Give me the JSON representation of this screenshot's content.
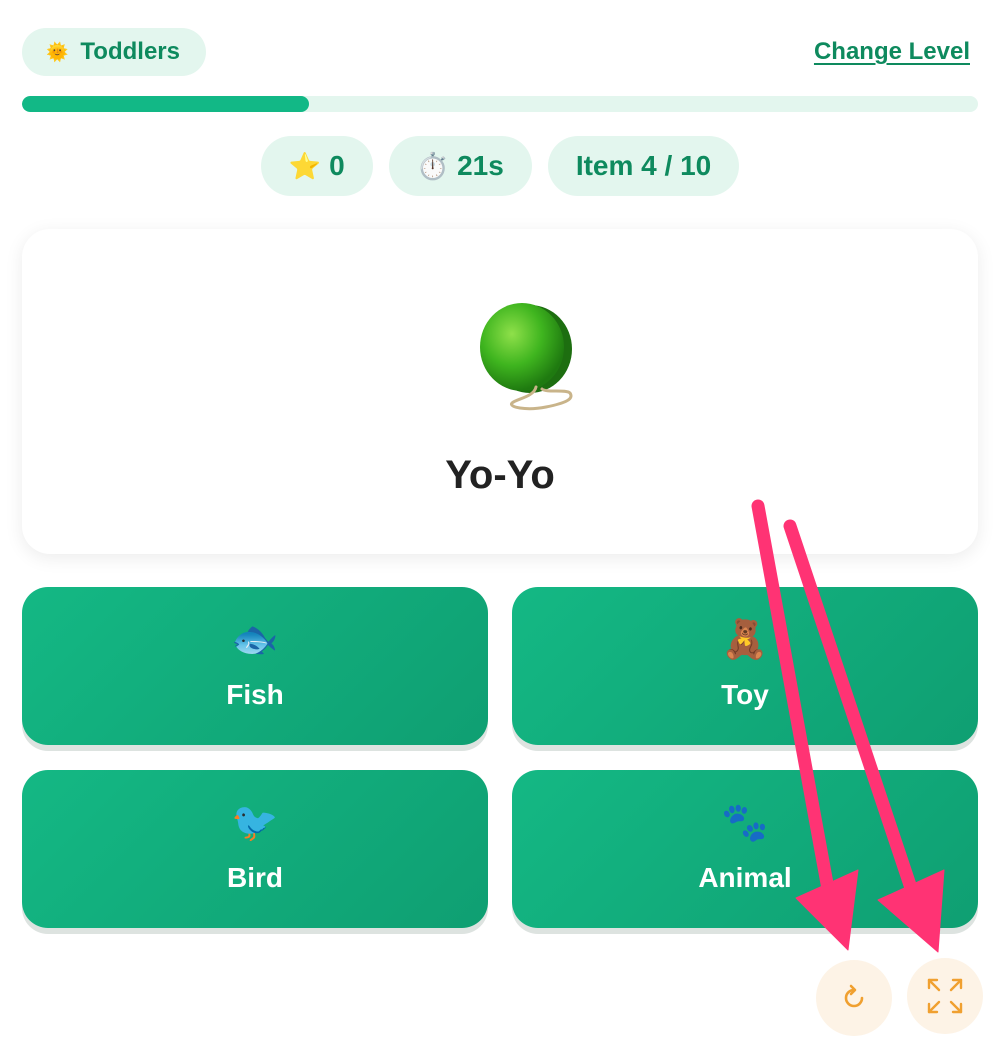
{
  "header": {
    "level_icon": "sun-icon",
    "level_label": "Toddlers",
    "change_level_label": "Change Level"
  },
  "progress": {
    "fraction": 0.3
  },
  "stats": {
    "stars_icon": "star-icon",
    "stars": "0",
    "timer_icon": "stopwatch-icon",
    "timer": "21s",
    "item_counter": "Item 4 / 10"
  },
  "item": {
    "icon": "yoyo-icon",
    "name": "Yo-Yo"
  },
  "choices": [
    {
      "icon": "fish-icon",
      "emoji": "🐟",
      "label": "Fish"
    },
    {
      "icon": "teddy-bear-icon",
      "emoji": "🧸",
      "label": "Toy"
    },
    {
      "icon": "bird-icon",
      "emoji": "🐦",
      "label": "Bird"
    },
    {
      "icon": "paw-prints-icon",
      "emoji": "🐾",
      "label": "Animal"
    }
  ],
  "controls": {
    "restart_icon": "restart-icon",
    "fullscreen_icon": "fullscreen-icon"
  },
  "colors": {
    "accent": "#12b886",
    "accent_dark": "#0e8a5e",
    "pill_bg": "#e3f6ee",
    "control_bg": "#fdf3e6",
    "control_icon": "#f0a030",
    "annotation_arrow": "#ff3374"
  }
}
